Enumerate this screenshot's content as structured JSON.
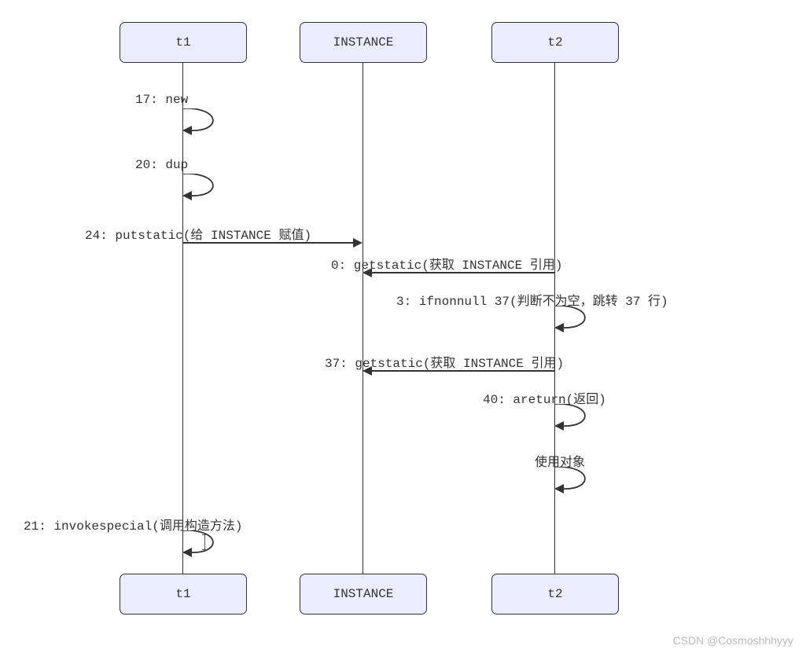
{
  "actors": {
    "t1": "t1",
    "instance": "INSTANCE",
    "t2": "t2"
  },
  "messages": {
    "m1": "17: new",
    "m2": "20: dup",
    "m3": "24: putstatic(给 INSTANCE 赋值)",
    "m4": "0: getstatic(获取 INSTANCE 引用)",
    "m5": "3: ifnonnull 37(判断不为空，跳转 37 行)",
    "m6": "37: getstatic(获取 INSTANCE 引用)",
    "m7": "40: areturn(返回)",
    "m8": "使用对象",
    "m9": "21: invokespecial(调用构造方法)"
  },
  "watermark": "CSDN @Cosmoshhhyyy"
}
